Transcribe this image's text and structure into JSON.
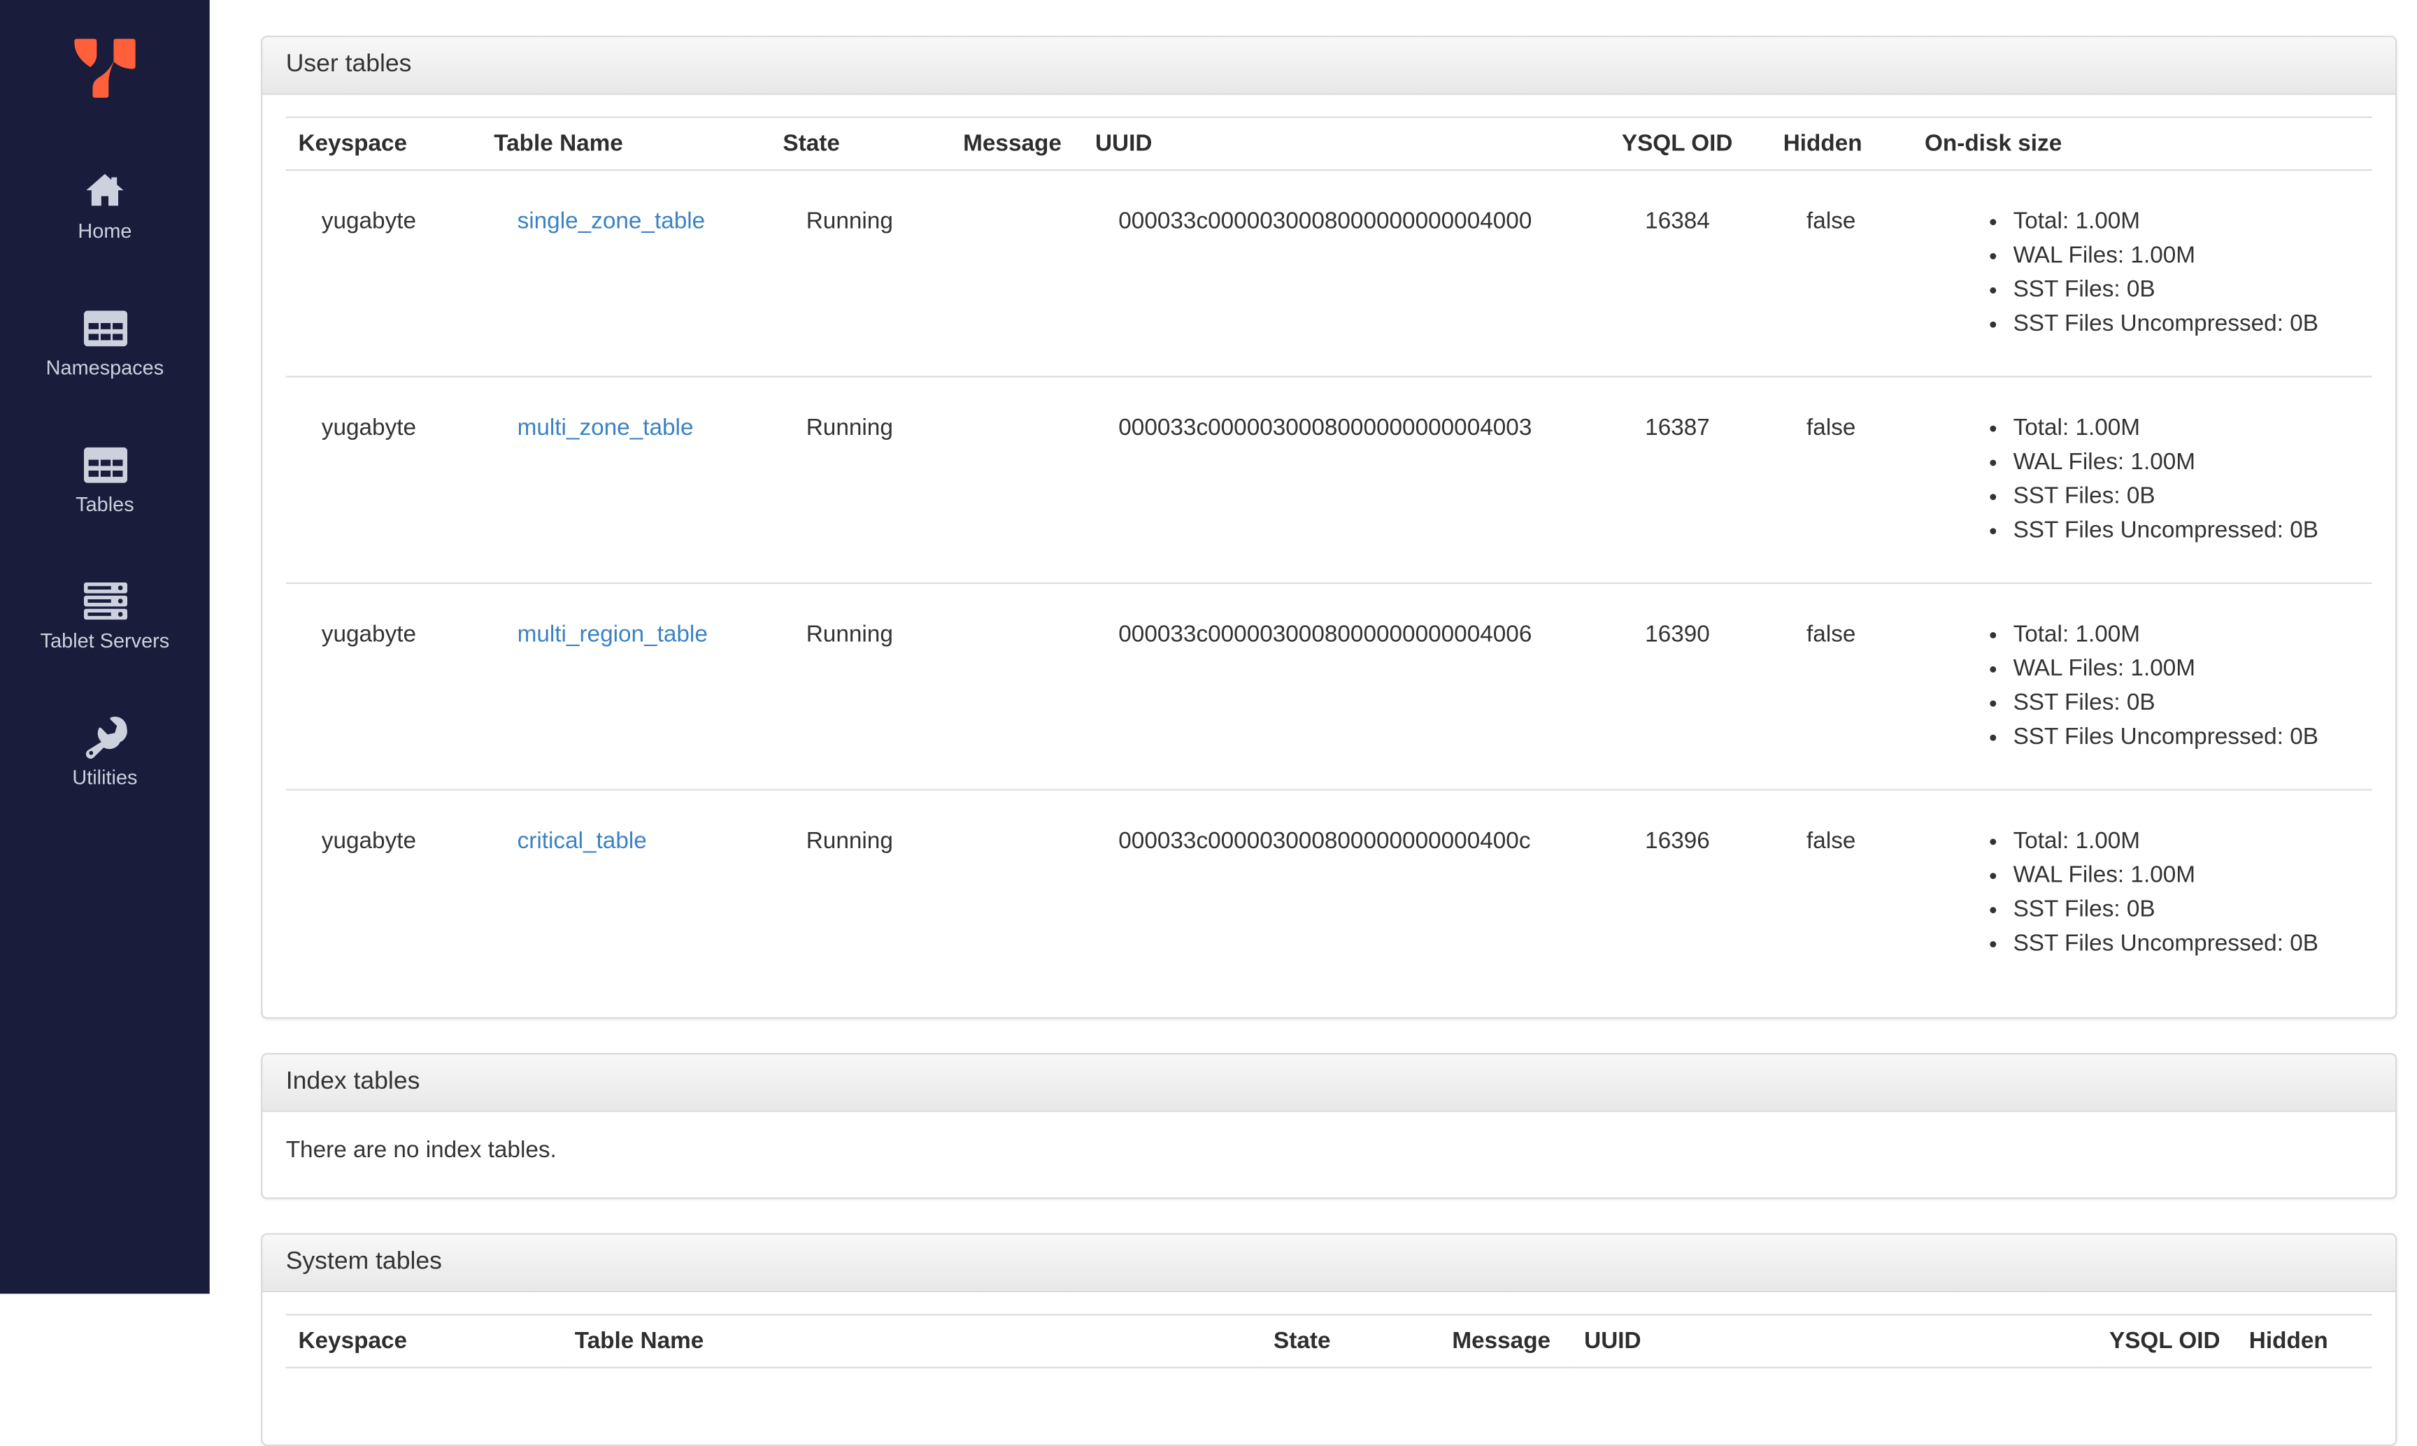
{
  "sidebar": {
    "items": [
      {
        "label": "Home",
        "icon": "home-icon"
      },
      {
        "label": "Namespaces",
        "icon": "namespaces-icon"
      },
      {
        "label": "Tables",
        "icon": "tables-icon"
      },
      {
        "label": "Tablet Servers",
        "icon": "tablet-servers-icon"
      },
      {
        "label": "Utilities",
        "icon": "utilities-icon"
      }
    ]
  },
  "user": {
    "title": "User tables",
    "columns": [
      "Keyspace",
      "Table Name",
      "State",
      "Message",
      "UUID",
      "YSQL OID",
      "Hidden",
      "On-disk size"
    ],
    "rows": [
      {
        "keyspace": "yugabyte",
        "table_name": "single_zone_table",
        "state": "Running",
        "message": "",
        "uuid": "000033c0000030008000000000004000",
        "ysql_oid": "16384",
        "hidden": "false",
        "on_disk": [
          "Total: 1.00M",
          "WAL Files: 1.00M",
          "SST Files: 0B",
          "SST Files Uncompressed: 0B"
        ]
      },
      {
        "keyspace": "yugabyte",
        "table_name": "multi_zone_table",
        "state": "Running",
        "message": "",
        "uuid": "000033c0000030008000000000004003",
        "ysql_oid": "16387",
        "hidden": "false",
        "on_disk": [
          "Total: 1.00M",
          "WAL Files: 1.00M",
          "SST Files: 0B",
          "SST Files Uncompressed: 0B"
        ]
      },
      {
        "keyspace": "yugabyte",
        "table_name": "multi_region_table",
        "state": "Running",
        "message": "",
        "uuid": "000033c0000030008000000000004006",
        "ysql_oid": "16390",
        "hidden": "false",
        "on_disk": [
          "Total: 1.00M",
          "WAL Files: 1.00M",
          "SST Files: 0B",
          "SST Files Uncompressed: 0B"
        ]
      },
      {
        "keyspace": "yugabyte",
        "table_name": "critical_table",
        "state": "Running",
        "message": "",
        "uuid": "000033c000003000800000000000400c",
        "ysql_oid": "16396",
        "hidden": "false",
        "on_disk": [
          "Total: 1.00M",
          "WAL Files: 1.00M",
          "SST Files: 0B",
          "SST Files Uncompressed: 0B"
        ]
      }
    ]
  },
  "index": {
    "title": "Index tables",
    "empty_message": "There are no index tables."
  },
  "system": {
    "title": "System tables",
    "columns": [
      "Keyspace",
      "Table Name",
      "State",
      "Message",
      "UUID",
      "YSQL OID",
      "Hidden"
    ]
  },
  "colors": {
    "sidebar_bg": "#191c3b",
    "accent_orange": "#ff5f3b",
    "link_blue": "#3b82c4",
    "panel_border": "#d9d9d9"
  }
}
